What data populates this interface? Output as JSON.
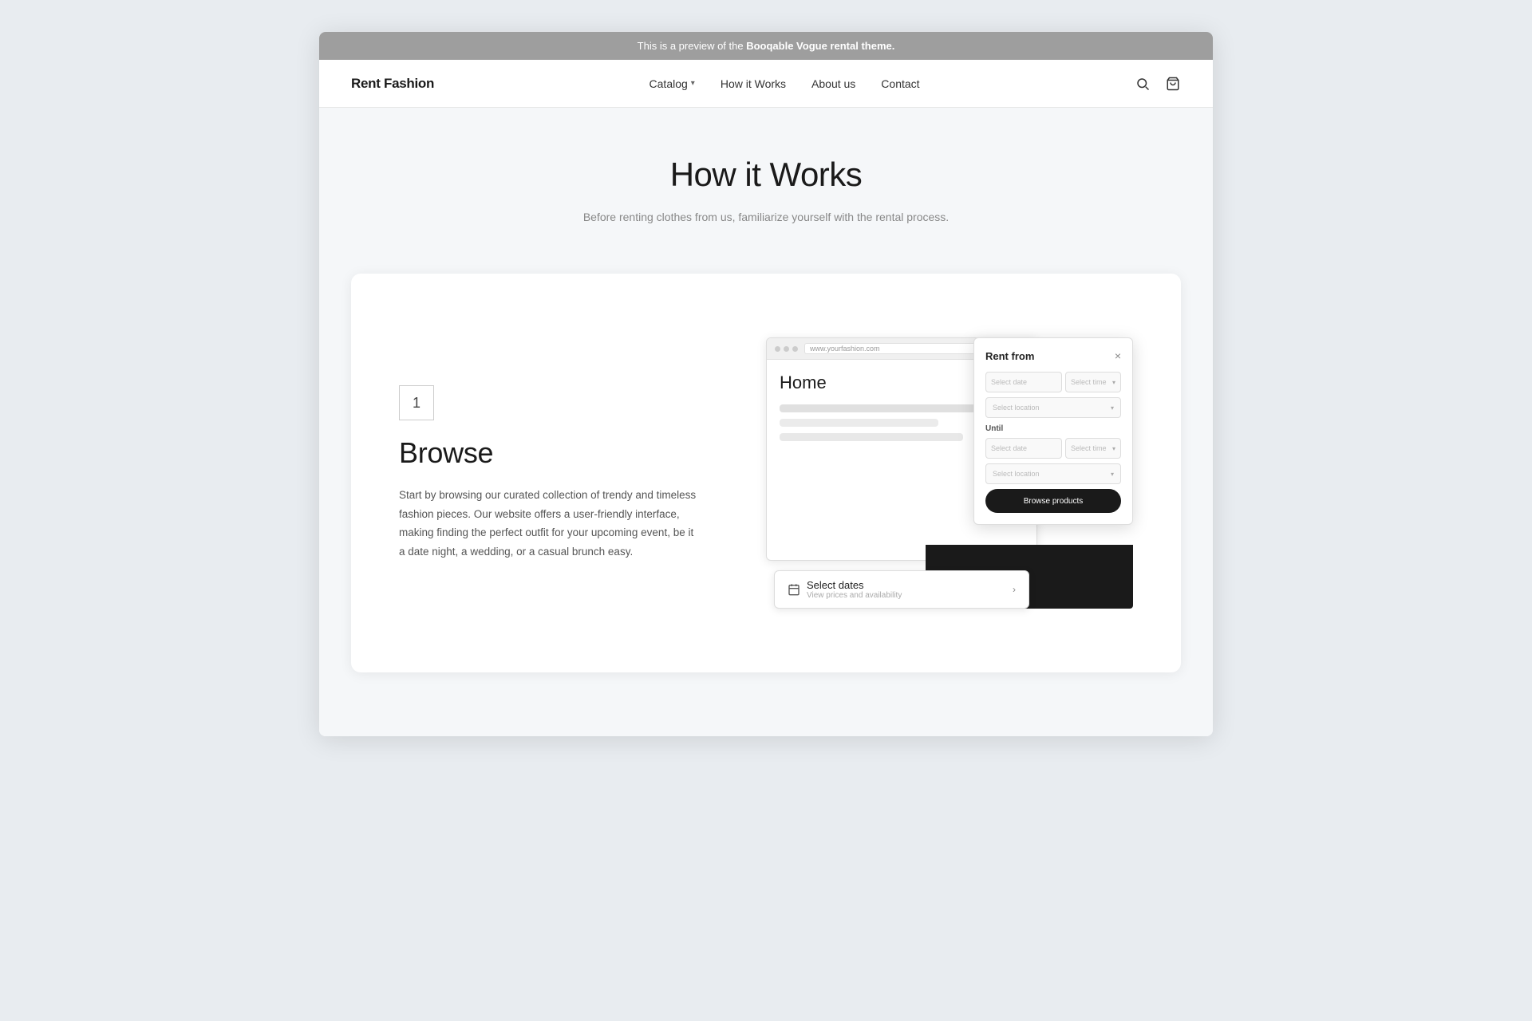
{
  "preview_banner": {
    "text_before": "This is a preview of the ",
    "brand_name": "Booqable Vogue rental theme.",
    "text_after": ""
  },
  "nav": {
    "logo": "Rent Fashion",
    "links": [
      {
        "label": "Catalog",
        "has_dropdown": true
      },
      {
        "label": "How it Works",
        "has_dropdown": false
      },
      {
        "label": "About us",
        "has_dropdown": false
      },
      {
        "label": "Contact",
        "has_dropdown": false
      }
    ],
    "icons": [
      "search",
      "cart"
    ]
  },
  "hero": {
    "title": "How it Works",
    "subtitle": "Before renting clothes from us, familiarize yourself with the rental process."
  },
  "step": {
    "number": "1",
    "title": "Browse",
    "description": "Start by browsing our curated collection of trendy and timeless fashion pieces. Our website offers a user-friendly interface, making finding the perfect outfit for your upcoming event, be it a date night, a wedding, or a casual brunch easy."
  },
  "mockup": {
    "url_text": "www.yourfashion.com",
    "home_label": "Home",
    "placeholder_lines": [
      "",
      "",
      ""
    ]
  },
  "rent_popup": {
    "title": "Rent from",
    "close": "×",
    "date_placeholder": "Select date",
    "time_placeholder": "Select time",
    "location_placeholder": "Select location",
    "until_label": "Until",
    "browse_btn": "Browse products"
  },
  "select_dates": {
    "label": "Select dates",
    "sublabel": "View prices and availability",
    "chevron": "›"
  }
}
